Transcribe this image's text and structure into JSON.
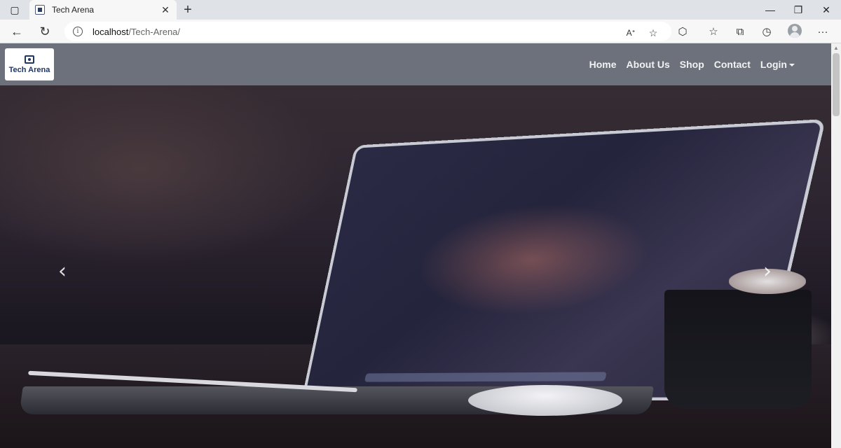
{
  "browser": {
    "tab_title": "Tech Arena",
    "url_host": "localhost",
    "url_path": "/Tech-Arena/"
  },
  "navbar": {
    "logo_text": "Tech Arena",
    "links": [
      "Home",
      "About Us",
      "Shop",
      "Contact"
    ],
    "login_label": "Login"
  },
  "carousel": {
    "prev_glyph": "‹",
    "next_glyph": "›"
  }
}
